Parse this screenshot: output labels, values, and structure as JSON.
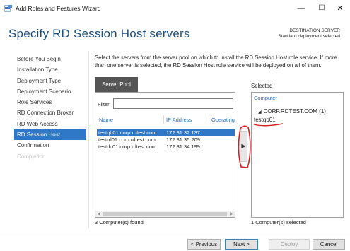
{
  "window": {
    "title": "Add Roles and Features Wizard",
    "controls": {
      "minimize": "—",
      "maximize": "☐",
      "close": "✕"
    }
  },
  "header": {
    "title": "Specify RD Session Host servers",
    "destination_label": "DESTINATION SERVER",
    "destination_value": "Standard deployment selected"
  },
  "nav": {
    "items": [
      {
        "label": "Before You Begin",
        "state": "normal"
      },
      {
        "label": "Installation Type",
        "state": "normal"
      },
      {
        "label": "Deployment Type",
        "state": "normal"
      },
      {
        "label": "Deployment Scenario",
        "state": "normal"
      },
      {
        "label": "Role Services",
        "state": "normal"
      },
      {
        "label": "RD Connection Broker",
        "state": "normal"
      },
      {
        "label": "RD Web Access",
        "state": "normal"
      },
      {
        "label": "RD Session Host",
        "state": "active"
      },
      {
        "label": "Confirmation",
        "state": "normal"
      },
      {
        "label": "Completion",
        "state": "disabled"
      }
    ]
  },
  "main": {
    "instructions": "Select the servers from the server pool on which to install the RD Session Host role service. If more than one server is selected, the RD Session Host role service will be deployed on all of them.",
    "pool_tab": "Server Pool",
    "filter_label": "Filter:",
    "filter_value": "",
    "columns": [
      "Name",
      "IP Address",
      "Operating"
    ],
    "rows": [
      {
        "name": "testqb01.corp.rdtest.com",
        "ip": "172.31.32.137",
        "selected": true
      },
      {
        "name": "testrd01.corp.rdtest.com",
        "ip": "172.31.35.209",
        "selected": false
      },
      {
        "name": "testdc01.corp.rdtest.com",
        "ip": "172.31.34.199",
        "selected": false
      }
    ],
    "pool_count": "3 Computer(s) found",
    "move_button": "▶",
    "selected_label": "Selected",
    "selected_column": "Computer",
    "selected_group": "CORP.RDTEST.COM (1)",
    "selected_group_toggle": "◢",
    "selected_item": "testqb01",
    "selected_count": "1 Computer(s) selected"
  },
  "footer": {
    "previous": "< Previous",
    "next": "Next >",
    "deploy": "Deploy",
    "cancel": "Cancel"
  },
  "colors": {
    "accent": "#2f77c7",
    "title": "#1d4f7c",
    "annotation": "#d62020"
  }
}
